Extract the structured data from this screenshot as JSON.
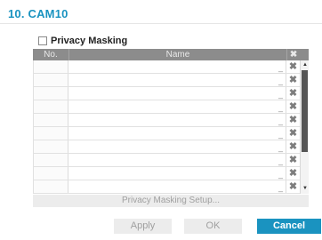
{
  "window": {
    "title": "10. CAM10"
  },
  "privacy_masking": {
    "label": "Privacy Masking",
    "checked": false
  },
  "table": {
    "columns": {
      "no": "No.",
      "name": "Name",
      "delete": "✖"
    },
    "rows": [
      {
        "no": "",
        "name": "",
        "underscore": "_",
        "delete": "✖"
      },
      {
        "no": "",
        "name": "",
        "underscore": "_",
        "delete": "✖"
      },
      {
        "no": "",
        "name": "",
        "underscore": "_",
        "delete": "✖"
      },
      {
        "no": "",
        "name": "",
        "underscore": "_",
        "delete": "✖"
      },
      {
        "no": "",
        "name": "",
        "underscore": "_",
        "delete": "✖"
      },
      {
        "no": "",
        "name": "",
        "underscore": "_",
        "delete": "✖"
      },
      {
        "no": "",
        "name": "",
        "underscore": "_",
        "delete": "✖"
      },
      {
        "no": "",
        "name": "",
        "underscore": "_",
        "delete": "✖"
      },
      {
        "no": "",
        "name": "",
        "underscore": "_",
        "delete": "✖"
      },
      {
        "no": "",
        "name": "",
        "underscore": "_",
        "delete": "✖"
      }
    ],
    "scroll_up": "▲",
    "scroll_down": "▼"
  },
  "setup_button": {
    "label": "Privacy Masking Setup..."
  },
  "footer": {
    "apply_label": "Apply",
    "ok_label": "OK",
    "cancel_label": "Cancel"
  },
  "colors": {
    "accent": "#1a93c0",
    "header_bg": "#8c8c8c",
    "disabled_bg": "#ececec",
    "disabled_text": "#a0a0a0"
  }
}
